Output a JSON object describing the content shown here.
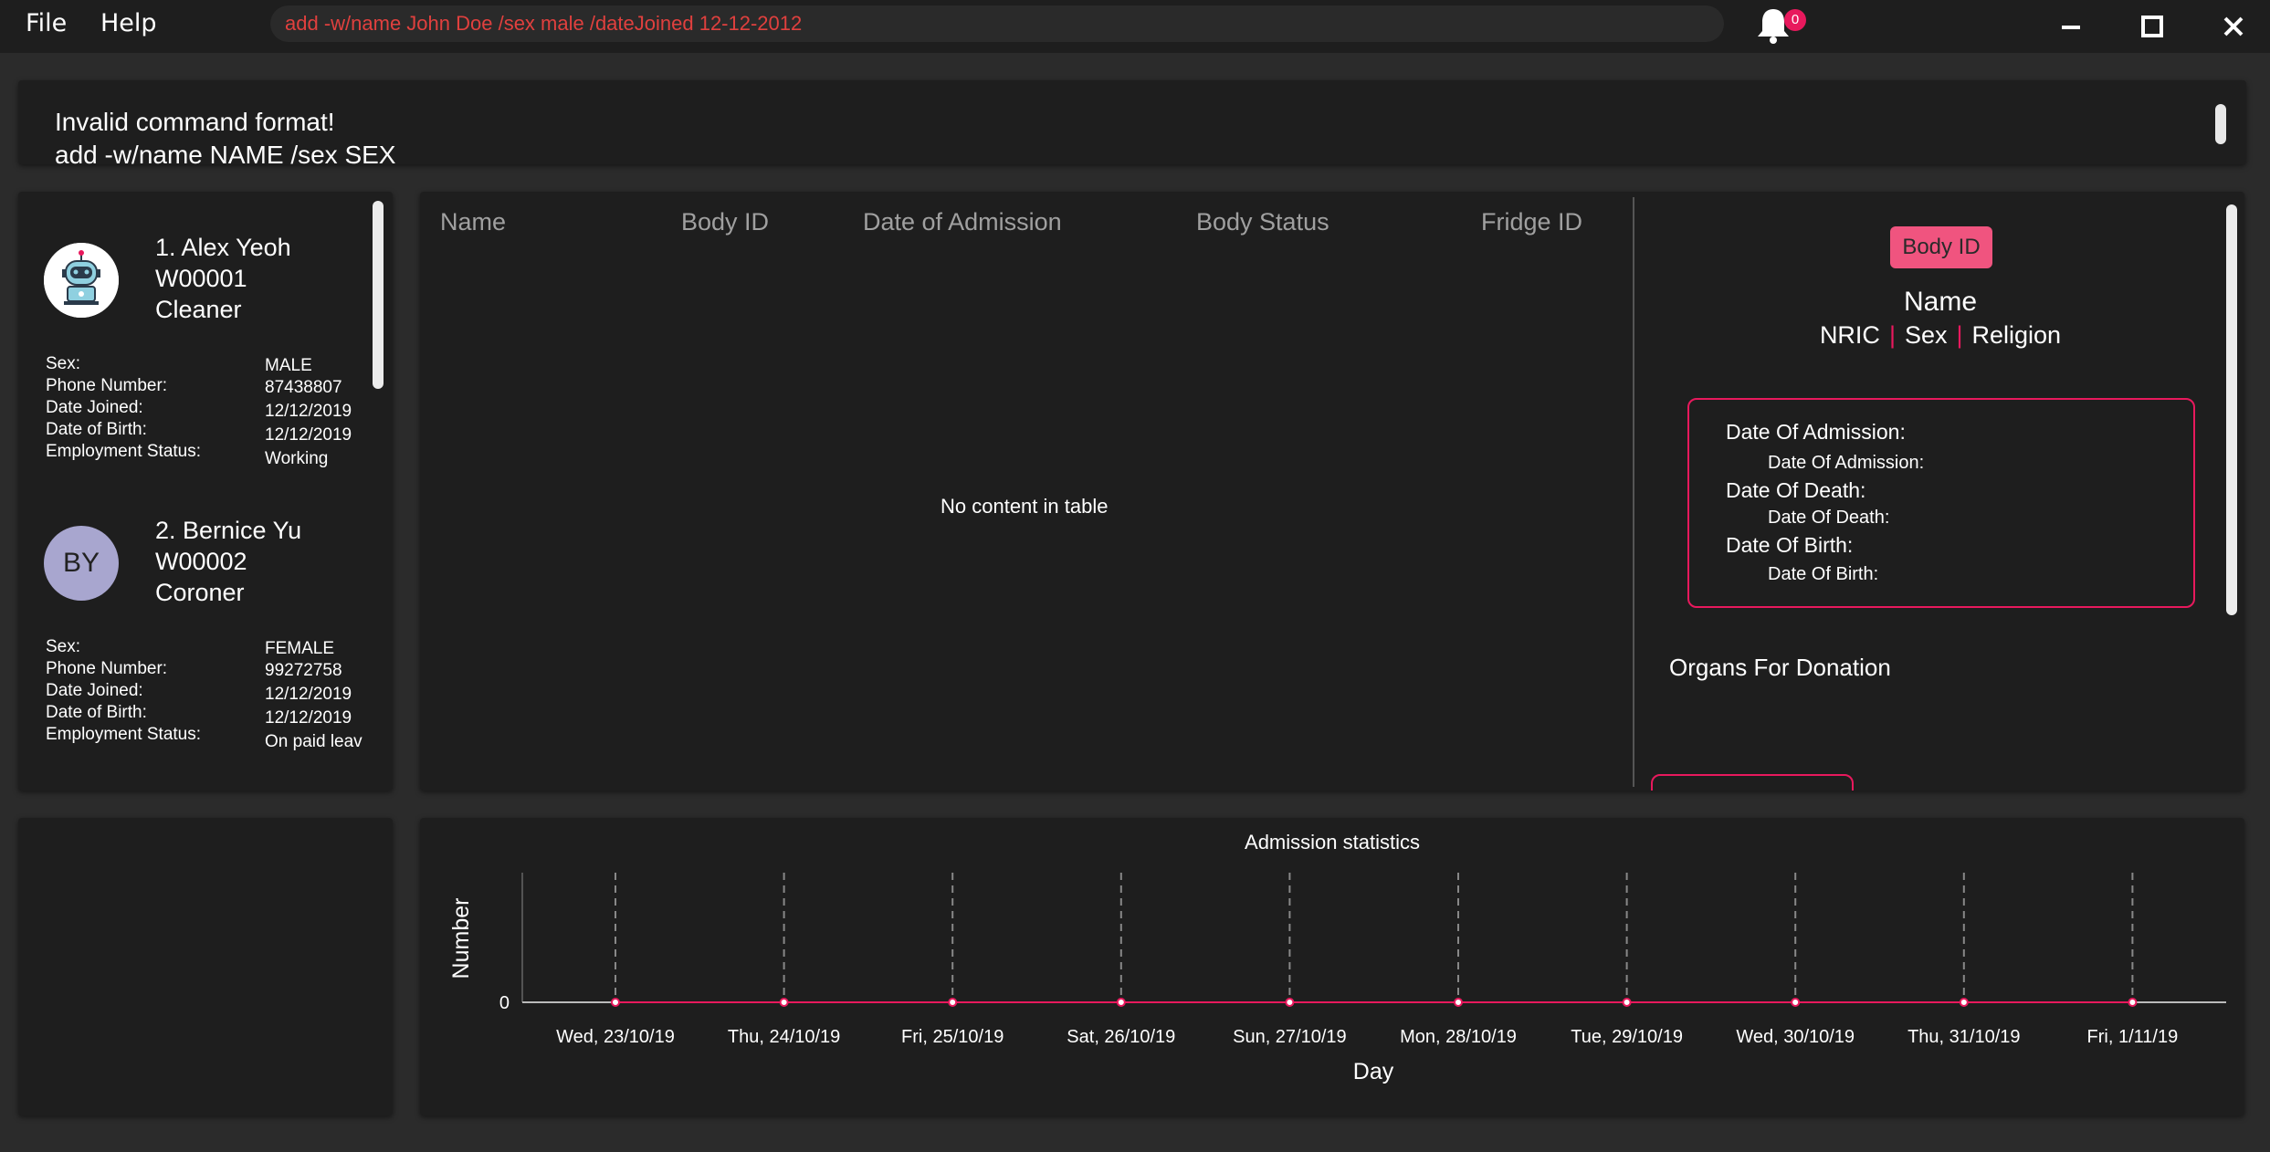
{
  "menu": {
    "file": "File",
    "help": "Help"
  },
  "command": {
    "value": "add -w/name John Doe /sex male /dateJoined 12-12-2012"
  },
  "notifications": {
    "count": "0",
    "icon": "bell-icon"
  },
  "window": {
    "minimize_icon": "minimize-icon",
    "maximize_icon": "maximize-icon",
    "close_icon": "close-icon"
  },
  "result": {
    "message": "Invalid command format!",
    "message_cont": "add -w/name NAME /sex SEX"
  },
  "workers": [
    {
      "title": "1. Alex Yeoh",
      "id": "W00001",
      "role": "Cleaner",
      "avatar_type": "robot-avatar",
      "labels": [
        "Sex:",
        "Phone Number:",
        "Date Joined:",
        "Date of Birth:",
        "Employment Status:"
      ],
      "values": [
        "MALE",
        "87438807",
        "12/12/2019",
        "12/12/2019",
        "Working"
      ]
    },
    {
      "title": "2. Bernice Yu",
      "id": "W00002",
      "role": "Coroner",
      "avatar_initials": "BY",
      "labels": [
        "Sex:",
        "Phone Number:",
        "Date Joined:",
        "Date of Birth:",
        "Employment Status:"
      ],
      "values": [
        "FEMALE",
        "99272758",
        "12/12/2019",
        "12/12/2019",
        "On paid leav"
      ]
    }
  ],
  "table": {
    "headers": [
      "Name",
      "Body ID",
      "Date of Admission",
      "Body Status",
      "Fridge ID"
    ],
    "empty_message": "No content in table"
  },
  "detail": {
    "body_id_label": "Body ID",
    "name": "Name",
    "nric": "NRIC",
    "sex": "Sex",
    "religion": "Religion",
    "separator": "|",
    "date_admission_label": "Date Of Admission:",
    "date_admission_value": "Date Of Admission:",
    "date_death_label": "Date Of Death:",
    "date_death_value": "Date Of Death:",
    "date_birth_label": "Date Of Birth:",
    "date_birth_value": "Date Of Birth:",
    "organs_label": "Organs For Donation"
  },
  "colors": {
    "accent": "#e8195d",
    "badge": "#f0547f",
    "background": "#1e1e1e",
    "avatar_bg": "#a8a6cf"
  },
  "chart_data": {
    "type": "line",
    "title": "Admission statistics",
    "xlabel": "Day",
    "ylabel": "Number",
    "categories": [
      "Wed, 23/10/19",
      "Thu, 24/10/19",
      "Fri, 25/10/19",
      "Sat, 26/10/19",
      "Sun, 27/10/19",
      "Mon, 28/10/19",
      "Tue, 29/10/19",
      "Wed, 30/10/19",
      "Thu, 31/10/19",
      "Fri, 1/11/19"
    ],
    "series": [
      {
        "values": [
          0,
          0,
          0,
          0,
          0,
          0,
          0,
          0,
          0,
          0
        ]
      }
    ],
    "yticks": [
      "0"
    ],
    "vertical_grid": true,
    "line_color": "#e8195d"
  }
}
